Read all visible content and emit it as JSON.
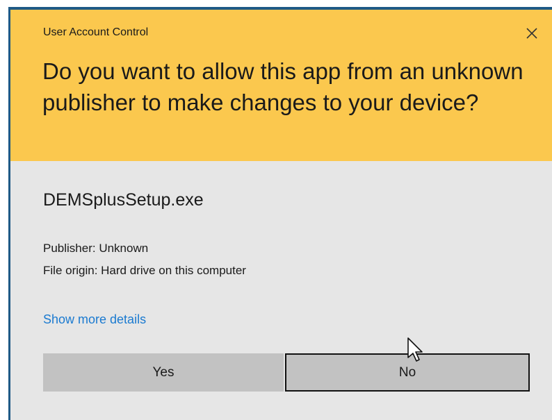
{
  "dialog": {
    "title": "User Account Control",
    "question": "Do you want to allow this app from an unknown publisher to make changes to your device?",
    "app_name": "DEMSplusSetup.exe",
    "publisher": "Publisher: Unknown",
    "file_origin": "File origin: Hard drive on this computer",
    "details_link": "Show more details",
    "yes_label": "Yes",
    "no_label": "No",
    "close_icon": "close-icon"
  },
  "colors": {
    "header_background": "#fbc84e",
    "body_background": "#e6e6e6",
    "link": "#1a7ad0",
    "button_background": "#c2c2c2",
    "frame": "#1f5a86"
  },
  "icons": {
    "close": "close-icon",
    "cursor": "mouse-cursor-icon"
  }
}
